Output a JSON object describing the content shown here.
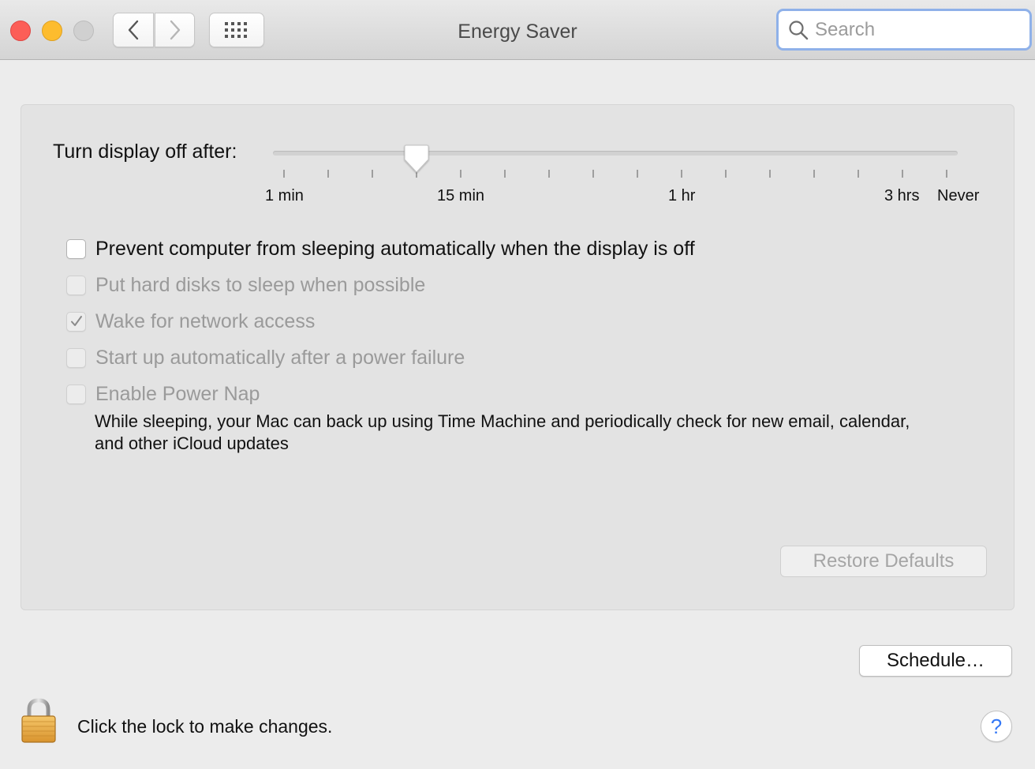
{
  "window": {
    "title": "Energy Saver",
    "traffic_lights": [
      "close",
      "minimize",
      "zoom"
    ]
  },
  "toolbar": {
    "back_icon": "chevron-left-icon",
    "forward_icon": "chevron-right-icon",
    "show_all_icon": "grid-icon"
  },
  "search": {
    "placeholder": "Search",
    "value": ""
  },
  "display_sleep": {
    "label": "Turn display off after:",
    "tick_labels": [
      "1 min",
      "15 min",
      "1 hr",
      "3 hrs",
      "Never"
    ],
    "tick_count": 16,
    "selected_value": "15 min"
  },
  "options": [
    {
      "label": "Prevent computer from sleeping automatically when the display is off",
      "checked": false,
      "enabled": true
    },
    {
      "label": "Put hard disks to sleep when possible",
      "checked": false,
      "enabled": false
    },
    {
      "label": "Wake for network access",
      "checked": true,
      "enabled": false
    },
    {
      "label": "Start up automatically after a power failure",
      "checked": false,
      "enabled": false
    },
    {
      "label": "Enable Power Nap",
      "checked": false,
      "enabled": false
    }
  ],
  "power_nap_description": "While sleeping, your Mac can back up using Time Machine and periodically check for new email, calendar, and other iCloud updates",
  "buttons": {
    "restore_defaults": "Restore Defaults",
    "schedule": "Schedule…",
    "help": "?"
  },
  "lock": {
    "text": "Click the lock to make changes.",
    "icon": "lock-icon"
  },
  "colors": {
    "close": "#fc5e57",
    "minimize": "#fdbc2e",
    "zoom": "#d0d0d0",
    "focus_ring": "#8fb1e9",
    "help_accent": "#3478f6",
    "disabled_text": "#9a9a9a"
  }
}
